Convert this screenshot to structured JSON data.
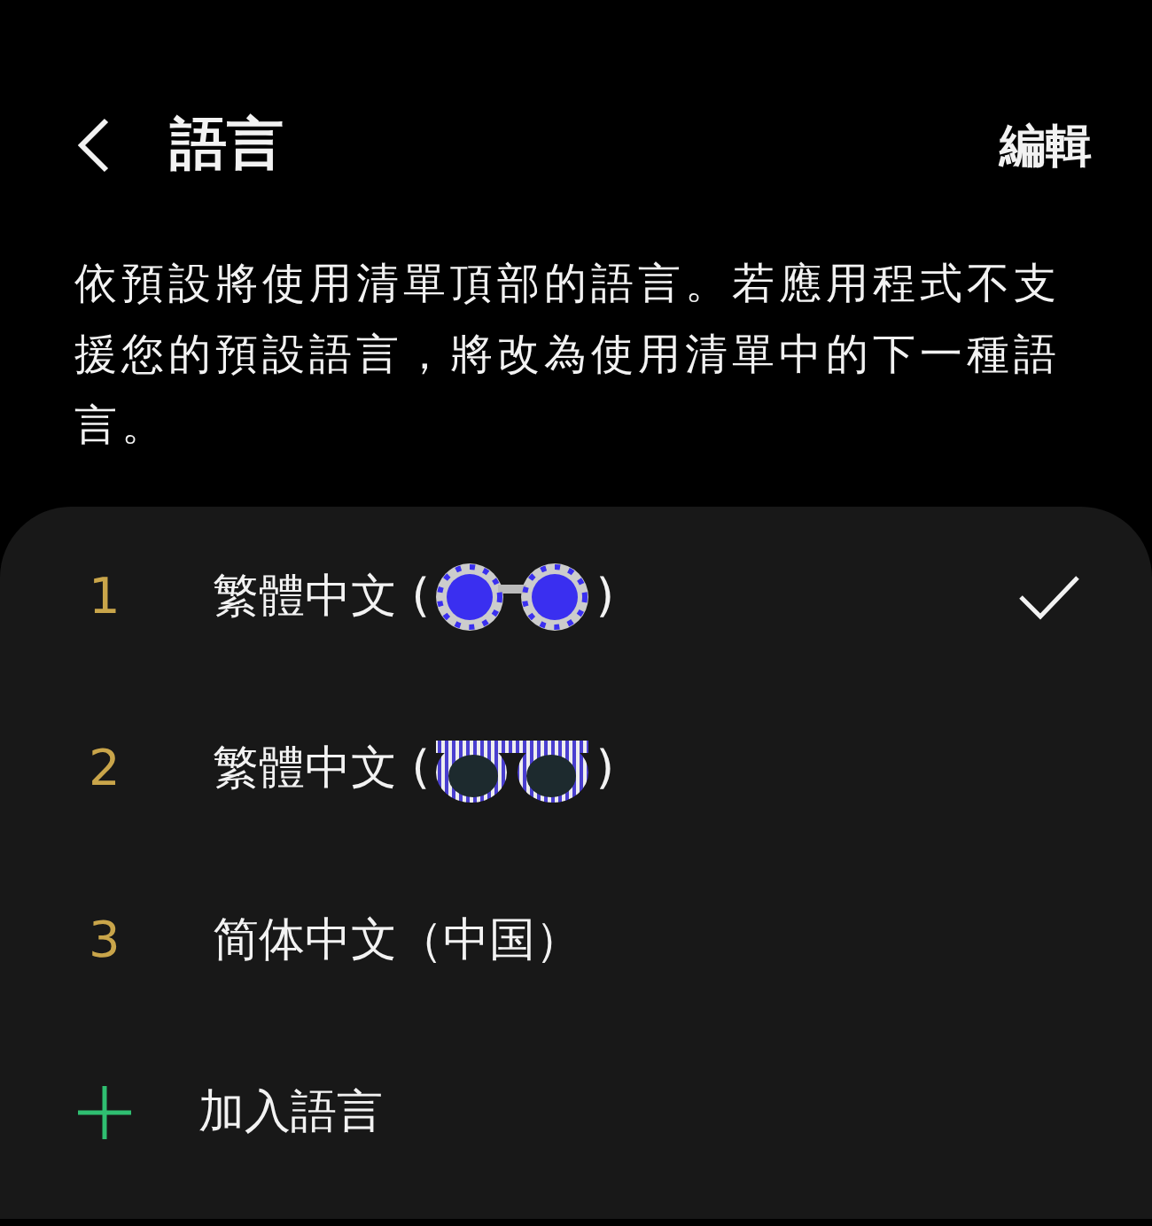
{
  "header": {
    "title": "語言",
    "action": "編輯"
  },
  "description": "依預設將使用清單頂部的語言。若應用程式不支援您的預設語言，將改為使用清單中的下一種語言。",
  "languages": [
    {
      "number": "1",
      "label": "繁體中文 (",
      "kind": "dotted",
      "suffix": ")",
      "selected": true
    },
    {
      "number": "2",
      "label": "繁體中文 (",
      "kind": "striped",
      "suffix": ")",
      "selected": false
    },
    {
      "number": "3",
      "label": "简体中文（中国）",
      "kind": "plain",
      "selected": false
    }
  ],
  "add": {
    "label": "加入語言"
  }
}
